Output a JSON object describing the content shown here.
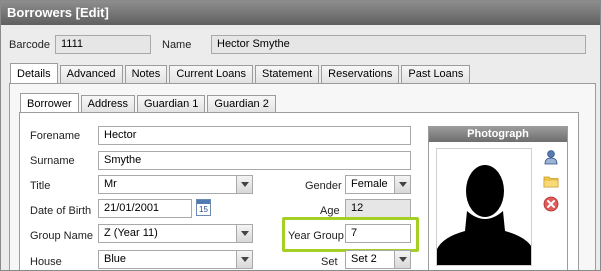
{
  "window": {
    "title": "Borrowers [Edit]"
  },
  "header": {
    "barcode_label": "Barcode",
    "barcode_value": "1111",
    "name_label": "Name",
    "name_value": "Hector Smythe"
  },
  "tabs": [
    "Details",
    "Advanced",
    "Notes",
    "Current Loans",
    "Statement",
    "Reservations",
    "Past Loans"
  ],
  "active_tab": "Details",
  "subtabs": [
    "Borrower",
    "Address",
    "Guardian 1",
    "Guardian 2"
  ],
  "active_subtab": "Borrower",
  "form": {
    "forename_label": "Forename",
    "forename": "Hector",
    "surname_label": "Surname",
    "surname": "Smythe",
    "title_label": "Title",
    "title": "Mr",
    "gender_label": "Gender",
    "gender": "Female",
    "dob_label": "Date of Birth",
    "dob": "21/01/2001",
    "age_label": "Age",
    "age": "12",
    "group_name_label": "Group Name",
    "group_name": "Z (Year 11)",
    "year_group_label": "Year Group",
    "year_group": "7",
    "house_label": "House",
    "house": "Blue",
    "set_label": "Set",
    "set": "Set 2"
  },
  "calendar_icon_text": "15",
  "photo": {
    "heading": "Photograph"
  },
  "colors": {
    "highlight": "#a5cf22",
    "titlebar": "#6e6e6e"
  },
  "icons": [
    "user-icon",
    "folder-icon",
    "remove-icon",
    "calendar-icon"
  ]
}
